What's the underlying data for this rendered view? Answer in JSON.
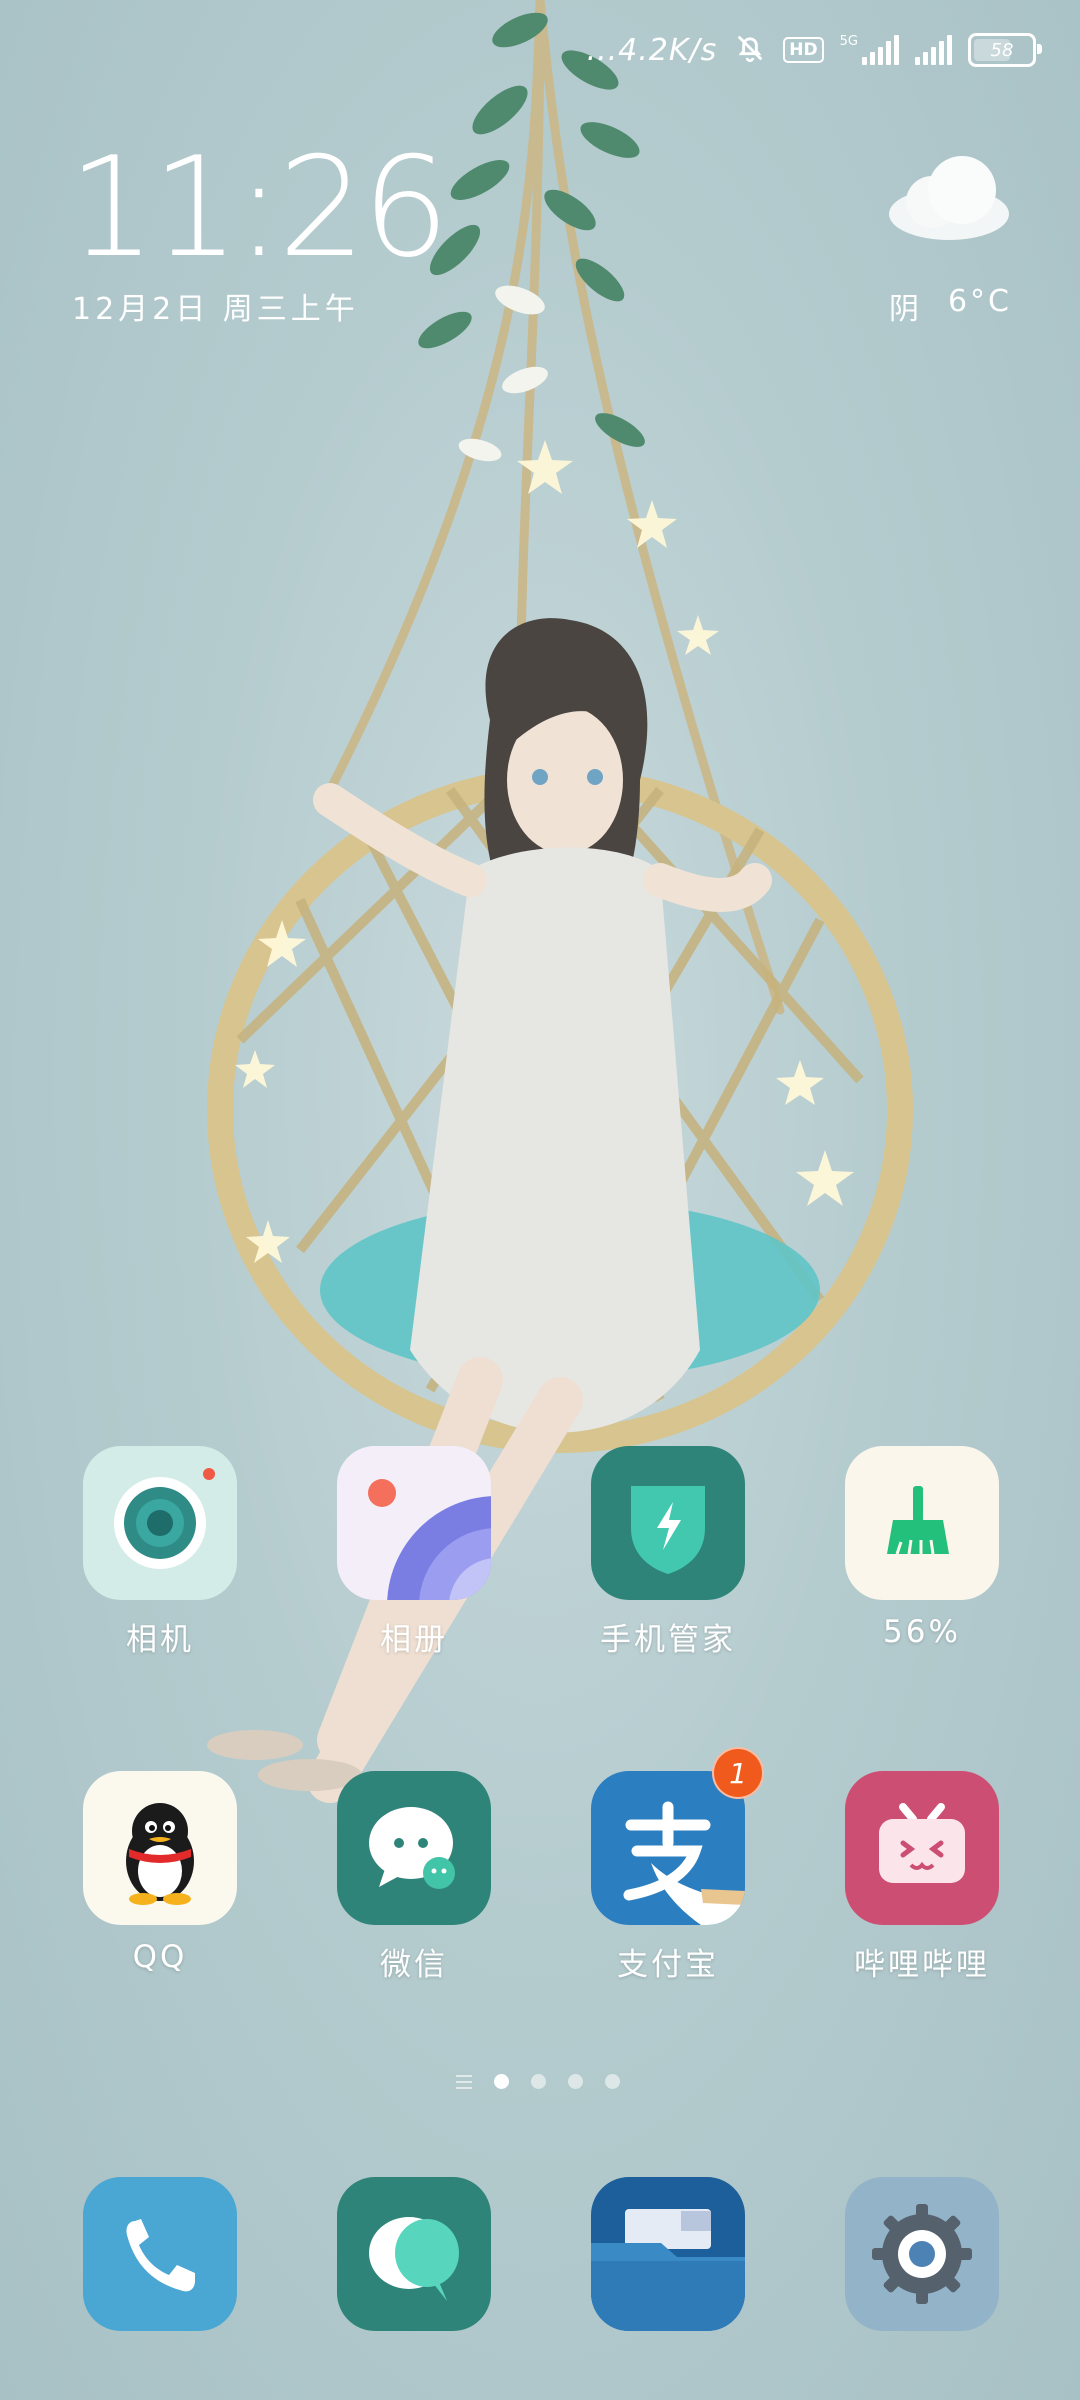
{
  "status_bar": {
    "network_speed": "4.2K/s",
    "hd": "HD",
    "network_type": "5G",
    "battery": "58",
    "battery_level": 0.58
  },
  "clock": {
    "time": "11:26",
    "date": "12月2日 周三上午"
  },
  "weather": {
    "condition": "阴",
    "temperature": "6°C",
    "icon": "cloud-icon"
  },
  "apps": [
    {
      "label": "相机",
      "icon": "camera-icon"
    },
    {
      "label": "相册",
      "icon": "gallery-icon"
    },
    {
      "label": "手机管家",
      "icon": "security-shield-icon"
    },
    {
      "label": "56%",
      "icon": "cleaner-broom-icon"
    },
    {
      "label": "QQ",
      "icon": "qq-penguin-icon"
    },
    {
      "label": "微信",
      "icon": "wechat-icon"
    },
    {
      "label": "支付宝",
      "icon": "alipay-icon",
      "badge": "1"
    },
    {
      "label": "哔哩哔哩",
      "icon": "bilibili-tv-icon"
    }
  ],
  "page_indicator": {
    "pages": 4,
    "current": 1
  },
  "dock": [
    {
      "icon": "phone-icon"
    },
    {
      "icon": "messages-icon"
    },
    {
      "icon": "files-folder-icon"
    },
    {
      "icon": "settings-gear-icon"
    }
  ],
  "colors": {
    "background": "#b5cccf",
    "badge": "#f15a1d"
  }
}
